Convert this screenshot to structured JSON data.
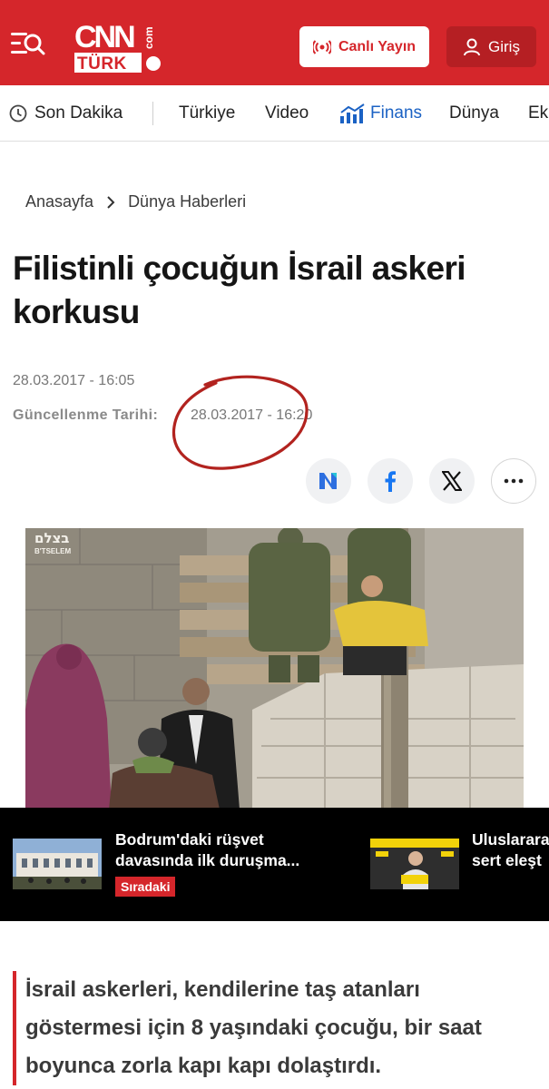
{
  "header": {
    "logo_top": "CNN",
    "logo_side": "com",
    "logo_bottom": "TÜRK",
    "live_label": "Canlı Yayın",
    "login_label": "Giriş"
  },
  "nav": {
    "items": [
      {
        "label": "Son Dakika",
        "icon": "clock-icon"
      },
      {
        "label": "Türkiye"
      },
      {
        "label": "Video"
      },
      {
        "label": "Finans",
        "icon": "chart-icon"
      },
      {
        "label": "Dünya"
      },
      {
        "label": "Ek"
      }
    ]
  },
  "breadcrumb": {
    "home": "Anasayfa",
    "section": "Dünya Haberleri"
  },
  "article": {
    "title": "Filistinli çocuğun İsrail askeri korkusu",
    "published": "28.03.2017 - 16:05",
    "updated_label": "Güncellenme Tarihi:",
    "updated": "28.03.2017 - 16:20",
    "lead": "İsrail askerleri, kendilerine taş atanları göstermesi için 8 yaşındaki çocuğu, bir saat boyunca zorla kapı kapı dolaştırdı."
  },
  "share": [
    "news-icon",
    "facebook-icon",
    "x-icon",
    "more-icon"
  ],
  "video": {
    "watermark_line1": "בצלם",
    "watermark_line2": "B'TSELEM"
  },
  "strip": {
    "item1": "Bodrum'daki rüşvet davasında ilk duruşma...",
    "badge": "Sıradaki",
    "item2_line1": "Uluslarara",
    "item2_line2": "sert eleşt"
  },
  "colors": {
    "brand_red": "#d5262b",
    "finans_blue": "#1b62c4"
  }
}
